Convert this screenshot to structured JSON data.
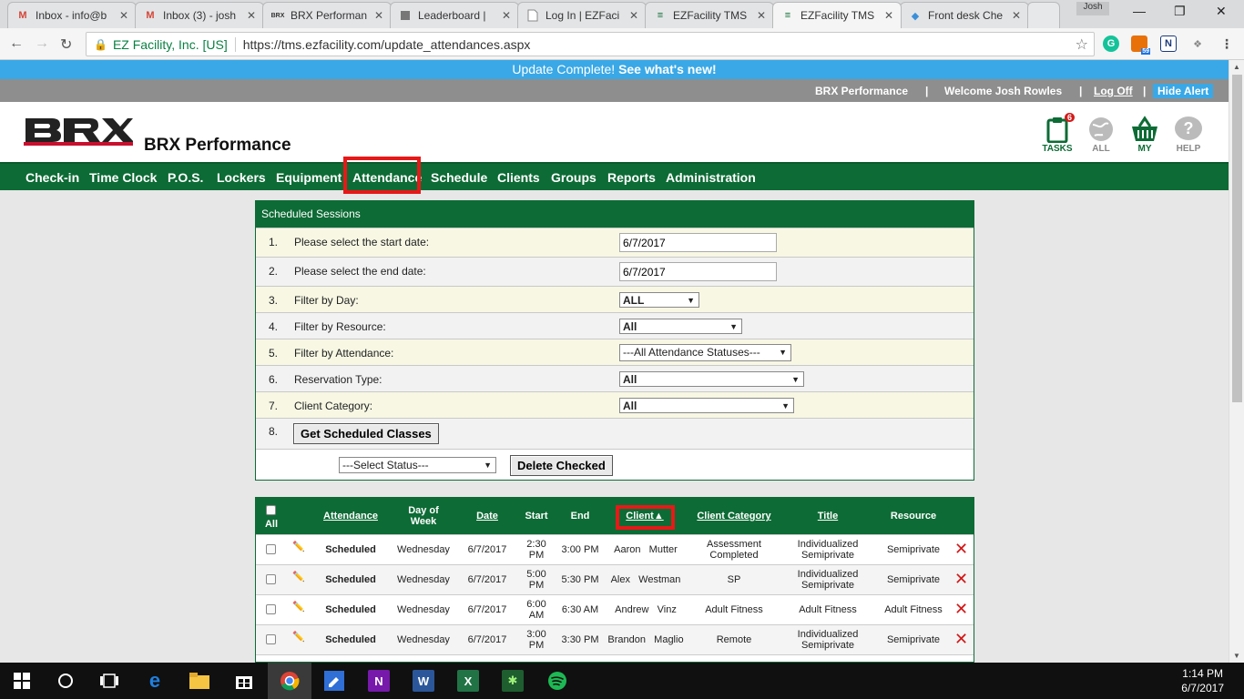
{
  "browser": {
    "tabs": [
      {
        "label": "Inbox - info@b",
        "icon": "gmail-icon"
      },
      {
        "label": "Inbox (3) - josh",
        "icon": "gmail-icon"
      },
      {
        "label": "BRX Performan",
        "icon": "brx-icon"
      },
      {
        "label": "Leaderboard |",
        "icon": "doc-icon"
      },
      {
        "label": "Log In | EZFaci",
        "icon": "page-icon"
      },
      {
        "label": "EZFacility TMS",
        "icon": "ezf-icon"
      },
      {
        "label": "EZFacility TMS",
        "icon": "ezf-icon"
      },
      {
        "label": "Front desk Che",
        "icon": "diamond-icon"
      }
    ],
    "user_badge": "Josh",
    "secure_label": "EZ Facility, Inc. [US]",
    "url": "https://tms.ezfacility.com/update_attendances.aspx",
    "ext_badge": "59"
  },
  "banner": {
    "text": "Update Complete! ",
    "link": "See what's new!"
  },
  "topbar": {
    "company": "BRX Performance",
    "sep": "|",
    "welcome": "Welcome Josh Rowles",
    "logout": "Log Off",
    "hide_alert": "Hide Alert"
  },
  "header": {
    "title": "BRX Performance",
    "icons": {
      "tasks": "TASKS",
      "tasks_badge": "6",
      "all": "ALL",
      "my": "MY",
      "help": "HELP"
    }
  },
  "nav": [
    "Check-in",
    "Time Clock",
    "P.O.S.",
    "Lockers",
    "Equipment",
    "Attendance",
    "Schedule",
    "Clients",
    "Groups",
    "Reports",
    "Administration"
  ],
  "panel": {
    "title": "Scheduled Sessions",
    "rows": [
      {
        "num": "1.",
        "label": "Please select the start date:",
        "value": "6/7/2017"
      },
      {
        "num": "2.",
        "label": "Please select the end date:",
        "value": "6/7/2017"
      },
      {
        "num": "3.",
        "label": "Filter by Day:",
        "value": "ALL"
      },
      {
        "num": "4.",
        "label": "Filter by Resource:",
        "value": "All"
      },
      {
        "num": "5.",
        "label": "Filter by Attendance:",
        "value": "---All Attendance Statuses---"
      },
      {
        "num": "6.",
        "label": "Reservation Type:",
        "value": "All"
      },
      {
        "num": "7.",
        "label": "Client Category:",
        "value": "All"
      },
      {
        "num": "8.",
        "label": "",
        "value": ""
      }
    ],
    "get_button": "Get Scheduled Classes",
    "status_select": "---Select Status---",
    "delete_button": "Delete Checked"
  },
  "table": {
    "headers": {
      "all": "All",
      "attendance": "Attendance",
      "dow1": "Day of",
      "dow2": "Week",
      "date": "Date",
      "start": "Start",
      "end": "End",
      "client": "Client▲",
      "category": "Client Category",
      "title": "Title",
      "resource": "Resource"
    },
    "rows": [
      {
        "status": "Scheduled",
        "dow": "Wednesday",
        "date": "6/7/2017",
        "start1": "2:30",
        "start2": "PM",
        "end": "3:00 PM",
        "client": "Aaron   Mutter",
        "cat1": "Assessment",
        "cat2": "Completed",
        "title1": "Individualized",
        "title2": "Semiprivate",
        "resource": "Semiprivate"
      },
      {
        "status": "Scheduled",
        "dow": "Wednesday",
        "date": "6/7/2017",
        "start1": "5:00",
        "start2": "PM",
        "end": "5:30 PM",
        "client": "Alex   Westman",
        "cat1": "SP",
        "cat2": "",
        "title1": "Individualized",
        "title2": "Semiprivate",
        "resource": "Semiprivate"
      },
      {
        "status": "Scheduled",
        "dow": "Wednesday",
        "date": "6/7/2017",
        "start1": "6:00",
        "start2": "AM",
        "end": "6:30 AM",
        "client": "Andrew   Vinz",
        "cat1": "Adult Fitness",
        "cat2": "",
        "title1": "Adult Fitness",
        "title2": "",
        "resource": "Adult Fitness"
      },
      {
        "status": "Scheduled",
        "dow": "Wednesday",
        "date": "6/7/2017",
        "start1": "3:00",
        "start2": "PM",
        "end": "3:30 PM",
        "client": "Brandon   Maglio",
        "cat1": "Remote",
        "cat2": "",
        "title1": "Individualized",
        "title2": "Semiprivate",
        "resource": "Semiprivate"
      }
    ]
  },
  "taskbar": {
    "time": "1:14 PM",
    "date": "6/7/2017"
  }
}
